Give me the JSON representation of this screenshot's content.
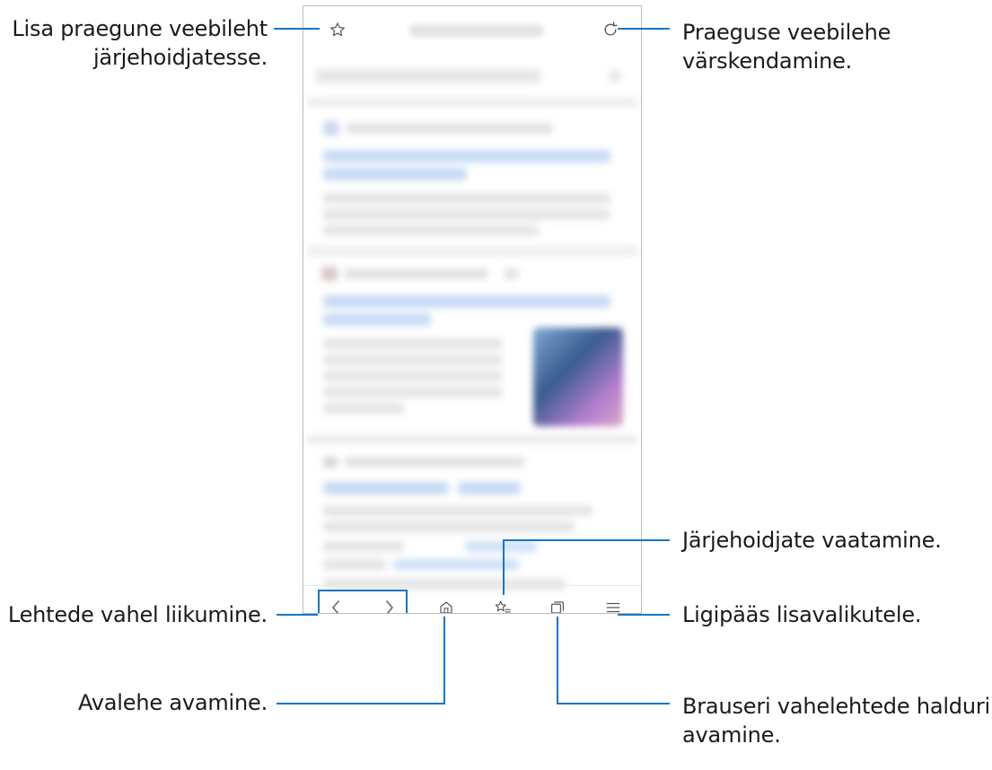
{
  "browser": {
    "top_bar": {
      "bookmark_icon": "star-outline-icon",
      "refresh_icon": "refresh-icon"
    },
    "bottom_bar": {
      "icons": [
        "chevron-left-icon",
        "chevron-right-icon",
        "home-icon",
        "bookmarks-list-icon",
        "tabs-icon",
        "menu-icon"
      ]
    }
  },
  "annotations": {
    "add_bookmark": [
      "Lisa praegune veebileht",
      "järjehoidjatesse."
    ],
    "refresh": [
      "Praeguse veebilehe",
      "värskendamine."
    ],
    "view_bookmarks": "Järjehoidjate vaatamine.",
    "navigate_pages": "Lehtede vahel liikumine.",
    "more_options": "Ligipääs lisavalikutele.",
    "open_home": "Avalehe avamine.",
    "tab_manager": [
      "Brauseri vahelehtede halduri",
      "avamine."
    ]
  },
  "colors": {
    "callout_line": "#1676c4",
    "frame": "#bdbdbd"
  }
}
